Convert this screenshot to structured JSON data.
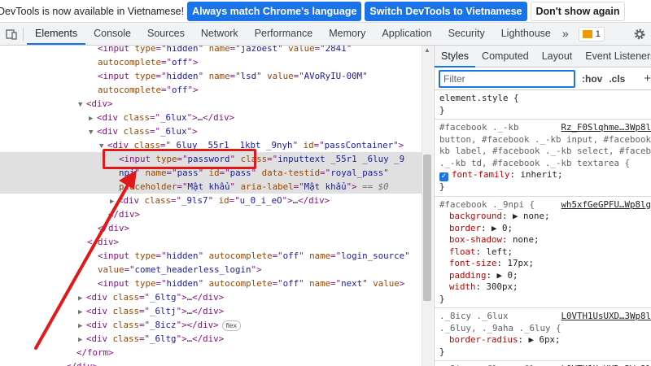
{
  "infobar": {
    "message": "DevTools is now available in Vietnamese!",
    "buttons": [
      "Always match Chrome's language",
      "Switch DevTools to Vietnamese",
      "Don't show again"
    ]
  },
  "toolbar": {
    "tabs": [
      "Elements",
      "Console",
      "Sources",
      "Network",
      "Performance",
      "Memory",
      "Application",
      "Security",
      "Lighthouse"
    ],
    "active_tab": "Elements",
    "more": "»",
    "issues_count": "1"
  },
  "elements": {
    "lines": [
      {
        "indent": 0,
        "tri": "",
        "html": [
          [
            "tag",
            "<input "
          ],
          [
            "an",
            "type"
          ],
          [
            "tag",
            "=\""
          ],
          [
            "av",
            "hidden"
          ],
          [
            "tag",
            "\" "
          ],
          [
            "an",
            "name"
          ],
          [
            "tag",
            "=\""
          ],
          [
            "av",
            "jazoest"
          ],
          [
            "tag",
            "\" "
          ],
          [
            "an",
            "value"
          ],
          [
            "tag",
            "=\""
          ],
          [
            "av",
            "2841"
          ],
          [
            "tag",
            "\""
          ]
        ]
      },
      {
        "indent": 0,
        "tri": "",
        "html": [
          [
            "an",
            "autocomplete"
          ],
          [
            "tag",
            "=\""
          ],
          [
            "av",
            "off"
          ],
          [
            "tag",
            "\">"
          ]
        ]
      },
      {
        "indent": 0,
        "tri": "",
        "html": [
          [
            "tag",
            "<input "
          ],
          [
            "an",
            "type"
          ],
          [
            "tag",
            "=\""
          ],
          [
            "av",
            "hidden"
          ],
          [
            "tag",
            "\" "
          ],
          [
            "an",
            "name"
          ],
          [
            "tag",
            "=\""
          ],
          [
            "av",
            "lsd"
          ],
          [
            "tag",
            "\" "
          ],
          [
            "an",
            "value"
          ],
          [
            "tag",
            "=\""
          ],
          [
            "av",
            "AVoRyIU-00M"
          ],
          [
            "tag",
            "\""
          ]
        ]
      },
      {
        "indent": 0,
        "tri": "",
        "html": [
          [
            "an",
            "autocomplete"
          ],
          [
            "tag",
            "=\""
          ],
          [
            "av",
            "off"
          ],
          [
            "tag",
            "\">"
          ]
        ]
      },
      {
        "indent": -1,
        "tri": "▼",
        "html": [
          [
            "tag",
            "<div>"
          ]
        ]
      },
      {
        "indent": 0,
        "tri": "▶",
        "html": [
          [
            "tag",
            "<div "
          ],
          [
            "an",
            "class"
          ],
          [
            "tag",
            "=\""
          ],
          [
            "av",
            "_6lux"
          ],
          [
            "tag",
            "\">"
          ],
          [
            "tx",
            "…"
          ],
          [
            "tag",
            "</div>"
          ]
        ]
      },
      {
        "indent": 0,
        "tri": "▼",
        "html": [
          [
            "tag",
            "<div "
          ],
          [
            "an",
            "class"
          ],
          [
            "tag",
            "=\""
          ],
          [
            "av",
            "_6lux"
          ],
          [
            "tag",
            "\">"
          ]
        ]
      },
      {
        "indent": 1,
        "tri": "▼",
        "html": [
          [
            "tag",
            "<div "
          ],
          [
            "an",
            "class"
          ],
          [
            "tag",
            "=\""
          ],
          [
            "av",
            "_6luy _55r1 _1kbt _9nyh"
          ],
          [
            "tag",
            "\" "
          ],
          [
            "an",
            "id"
          ],
          [
            "tag",
            "=\""
          ],
          [
            "av",
            "passContainer"
          ],
          [
            "tag",
            "\">"
          ]
        ]
      },
      {
        "indent": 2,
        "tri": "",
        "sel": true,
        "html": [
          [
            "tag",
            "<input "
          ],
          [
            "an",
            "type"
          ],
          [
            "tag",
            "=\""
          ],
          [
            "av",
            "password"
          ],
          [
            "tag",
            "\" "
          ],
          [
            "an",
            "class"
          ],
          [
            "tag",
            "=\""
          ],
          [
            "av",
            "inputtext _55r1 _6luy _9"
          ]
        ]
      },
      {
        "indent": 2,
        "tri": "",
        "sel": true,
        "html": [
          [
            "av",
            "npi"
          ],
          [
            "tag",
            "\" "
          ],
          [
            "an",
            "name"
          ],
          [
            "tag",
            "=\""
          ],
          [
            "av",
            "pass"
          ],
          [
            "tag",
            "\" "
          ],
          [
            "an",
            "id"
          ],
          [
            "tag",
            "=\""
          ],
          [
            "av",
            "pass"
          ],
          [
            "tag",
            "\" "
          ],
          [
            "an",
            "data-testid"
          ],
          [
            "tag",
            "=\""
          ],
          [
            "av",
            "royal_pass"
          ],
          [
            "tag",
            "\""
          ]
        ]
      },
      {
        "indent": 2,
        "tri": "",
        "sel": true,
        "html": [
          [
            "an",
            "placeholder"
          ],
          [
            "tag",
            "=\""
          ],
          [
            "av",
            "Mật khẩu"
          ],
          [
            "tag",
            "\" "
          ],
          [
            "an",
            "aria-label"
          ],
          [
            "tag",
            "=\""
          ],
          [
            "av",
            "Mật khẩu"
          ],
          [
            "tag",
            "\">"
          ],
          [
            "eq0",
            " == $0"
          ]
        ]
      },
      {
        "indent": 2,
        "tri": "▶",
        "html": [
          [
            "tag",
            "<div "
          ],
          [
            "an",
            "class"
          ],
          [
            "tag",
            "=\""
          ],
          [
            "av",
            "_9ls7"
          ],
          [
            "tag",
            "\" "
          ],
          [
            "an",
            "id"
          ],
          [
            "tag",
            "=\""
          ],
          [
            "av",
            "u_0_i_eO"
          ],
          [
            "tag",
            "\">"
          ],
          [
            "tx",
            "…"
          ],
          [
            "tag",
            "</div>"
          ]
        ]
      },
      {
        "indent": 1,
        "tri": "",
        "html": [
          [
            "tag",
            "</div>"
          ]
        ]
      },
      {
        "indent": 0,
        "tri": "",
        "html": [
          [
            "tag",
            "</div>"
          ]
        ]
      },
      {
        "indent": -1,
        "tri": "",
        "html": [
          [
            "tag",
            "</div>"
          ]
        ]
      },
      {
        "indent": 0,
        "tri": "",
        "html": [
          [
            "tag",
            "<input "
          ],
          [
            "an",
            "type"
          ],
          [
            "tag",
            "=\""
          ],
          [
            "av",
            "hidden"
          ],
          [
            "tag",
            "\" "
          ],
          [
            "an",
            "autocomplete"
          ],
          [
            "tag",
            "=\""
          ],
          [
            "av",
            "off"
          ],
          [
            "tag",
            "\" "
          ],
          [
            "an",
            "name"
          ],
          [
            "tag",
            "=\""
          ],
          [
            "av",
            "login_source"
          ],
          [
            "tag",
            "\""
          ]
        ]
      },
      {
        "indent": 0,
        "tri": "",
        "html": [
          [
            "an",
            "value"
          ],
          [
            "tag",
            "=\""
          ],
          [
            "av",
            "comet_headerless_login"
          ],
          [
            "tag",
            "\">"
          ]
        ]
      },
      {
        "indent": 0,
        "tri": "",
        "html": [
          [
            "tag",
            "<input "
          ],
          [
            "an",
            "type"
          ],
          [
            "tag",
            "=\""
          ],
          [
            "av",
            "hidden"
          ],
          [
            "tag",
            "\" "
          ],
          [
            "an",
            "autocomplete"
          ],
          [
            "tag",
            "=\""
          ],
          [
            "av",
            "off"
          ],
          [
            "tag",
            "\" "
          ],
          [
            "an",
            "name"
          ],
          [
            "tag",
            "=\""
          ],
          [
            "av",
            "next"
          ],
          [
            "tag",
            "\" "
          ],
          [
            "an",
            "value"
          ],
          [
            "tag",
            ">"
          ]
        ]
      },
      {
        "indent": -1,
        "tri": "▶",
        "html": [
          [
            "tag",
            "<div "
          ],
          [
            "an",
            "class"
          ],
          [
            "tag",
            "=\""
          ],
          [
            "av",
            "_6ltg"
          ],
          [
            "tag",
            "\">"
          ],
          [
            "tx",
            "…"
          ],
          [
            "tag",
            "</div>"
          ]
        ]
      },
      {
        "indent": -1,
        "tri": "▶",
        "html": [
          [
            "tag",
            "<div "
          ],
          [
            "an",
            "class"
          ],
          [
            "tag",
            "=\""
          ],
          [
            "av",
            "_6ltj"
          ],
          [
            "tag",
            "\">"
          ],
          [
            "tx",
            "…"
          ],
          [
            "tag",
            "</div>"
          ]
        ]
      },
      {
        "indent": -1,
        "tri": "▶",
        "html": [
          [
            "tag",
            "<div "
          ],
          [
            "an",
            "class"
          ],
          [
            "tag",
            "=\""
          ],
          [
            "av",
            "_8icz"
          ],
          [
            "tag",
            "\">"
          ],
          [
            "tag",
            "</div>"
          ]
        ],
        "badge": "flex"
      },
      {
        "indent": -1,
        "tri": "▶",
        "html": [
          [
            "tag",
            "<div "
          ],
          [
            "an",
            "class"
          ],
          [
            "tag",
            "=\""
          ],
          [
            "av",
            "_6ltg"
          ],
          [
            "tag",
            "\">"
          ],
          [
            "tx",
            "…"
          ],
          [
            "tag",
            "</div>"
          ]
        ]
      },
      {
        "indent": -2,
        "tri": "",
        "html": [
          [
            "tag",
            "</form>"
          ]
        ]
      },
      {
        "indent": -3,
        "tri": "",
        "html": [
          [
            "tag",
            "</div>"
          ]
        ]
      }
    ]
  },
  "styles": {
    "tabs": [
      "Styles",
      "Computed",
      "Layout",
      "Event Listeners"
    ],
    "active_tab": "Styles",
    "filter_placeholder": "Filter",
    "hov": ":hov",
    "cls": ".cls",
    "plus": "+",
    "rules": [
      {
        "selector": [
          "element.style {"
        ],
        "source": "",
        "props": [],
        "check": false
      },
      {
        "selector": [
          "#facebook ._-kb",
          "button, #facebook ._-kb input, #facebook",
          "kb label, #facebook ._-kb select, #faceb",
          "._-kb td, #facebook ._-kb textarea {"
        ],
        "source": "Rz_F0Slqhme…3Wp8l",
        "props": [
          [
            "font-family",
            "inherit"
          ]
        ],
        "check": true
      },
      {
        "selector": [
          "#facebook ._9npi {"
        ],
        "source": "wh5xfGeGPFU…Wp8lg",
        "props": [
          [
            "background",
            "▶ none"
          ],
          [
            "border",
            "▶ 0"
          ],
          [
            "box-shadow",
            "none"
          ],
          [
            "float",
            "left"
          ],
          [
            "font-size",
            "17px"
          ],
          [
            "padding",
            "▶ 0"
          ],
          [
            "width",
            "300px"
          ]
        ],
        "check": false
      },
      {
        "selector": [
          "._8icy ._6lux",
          "._6luy, ._9aha ._6luy {"
        ],
        "source": "L0VTH1UsUXD…3Wp8l",
        "props": [
          [
            "border-radius",
            "▶ 6px"
          ]
        ],
        "check": false
      },
      {
        "selector": [
          "._8icy ._6lux ._6luy"
        ],
        "source": "L0VTH1UsUXD…3Wp8l",
        "props": [],
        "check": false
      }
    ]
  }
}
